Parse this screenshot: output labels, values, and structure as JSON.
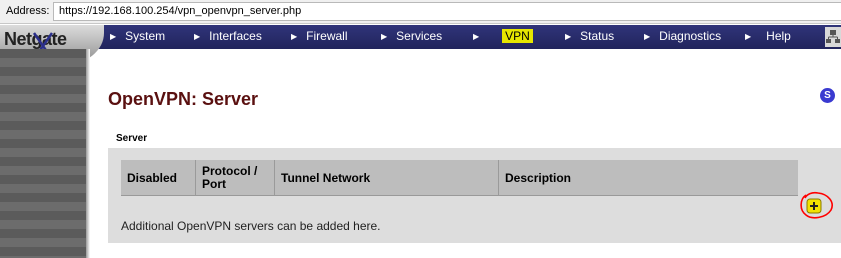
{
  "browser": {
    "address_label": "Address:",
    "url": "https://192.168.100.254/vpn_openvpn_server.php"
  },
  "logo": {
    "text": "Netgate"
  },
  "nav": {
    "items": [
      {
        "label": "System"
      },
      {
        "label": "Interfaces"
      },
      {
        "label": "Firewall"
      },
      {
        "label": "Services"
      },
      {
        "label": "VPN",
        "active": true
      },
      {
        "label": "Status"
      },
      {
        "label": "Diagnostics"
      },
      {
        "label": "Help"
      }
    ]
  },
  "page": {
    "title": "OpenVPN: Server",
    "help_icon_label": "S",
    "section_label": "Server",
    "table": {
      "columns": [
        "Disabled",
        "Protocol / Port",
        "Tunnel Network",
        "Description"
      ]
    },
    "note": "Additional OpenVPN servers can be added here."
  },
  "colors": {
    "nav_bg": "#26296a",
    "active_highlight": "#e6e600",
    "title": "#5a1010",
    "annotation": "#ff0000"
  }
}
